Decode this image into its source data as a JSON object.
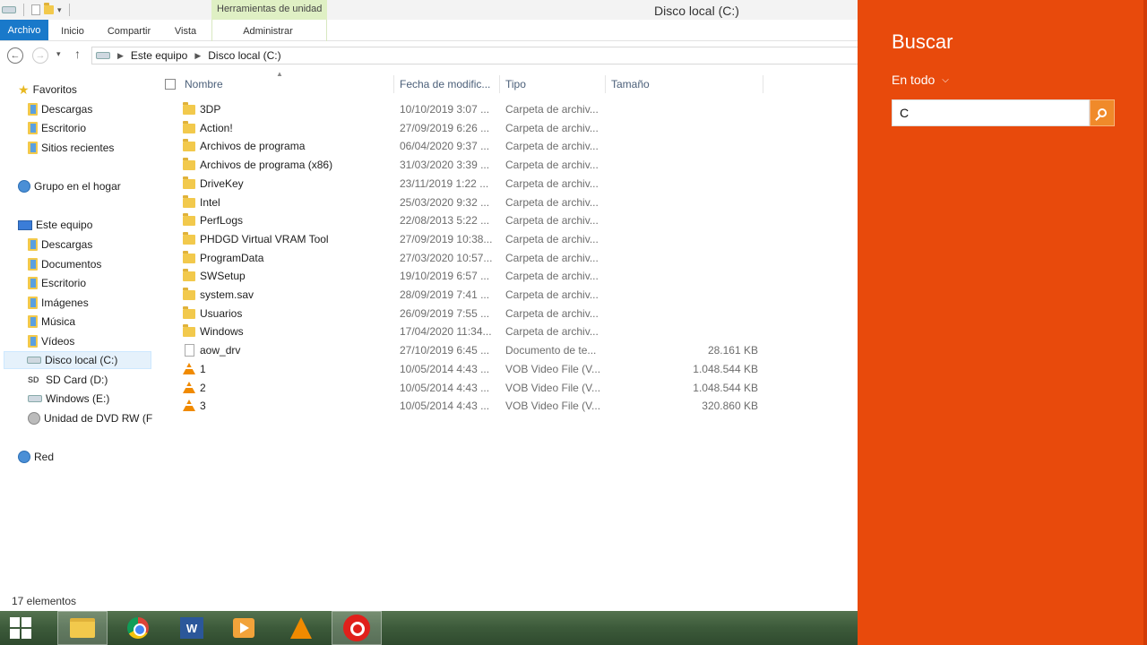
{
  "window": {
    "title": "Disco local (C:)",
    "tools_tab": "Herramientas de unidad"
  },
  "ribbon": {
    "tabs": [
      "Archivo",
      "Inicio",
      "Compartir",
      "Vista",
      "Administrar"
    ]
  },
  "address": {
    "crumbs": [
      "Este equipo",
      "Disco local (C:)"
    ]
  },
  "nav": {
    "favorites": "Favoritos",
    "fav_items": [
      "Descargas",
      "Escritorio",
      "Sitios recientes"
    ],
    "homegroup": "Grupo en el hogar",
    "this_pc": "Este equipo",
    "pc_items": [
      "Descargas",
      "Documentos",
      "Escritorio",
      "Imágenes",
      "Música",
      "Vídeos",
      "Disco local (C:)",
      "SD Card (D:)",
      "Windows (E:)",
      "Unidad de DVD RW (F"
    ],
    "network": "Red"
  },
  "columns": [
    "Nombre",
    "Fecha de modific...",
    "Tipo",
    "Tamaño"
  ],
  "files": [
    {
      "name": "3DP",
      "date": "10/10/2019 3:07 ...",
      "type": "Carpeta de archiv...",
      "size": "",
      "icon": "folder-icon"
    },
    {
      "name": "Action!",
      "date": "27/09/2019 6:26 ...",
      "type": "Carpeta de archiv...",
      "size": "",
      "icon": "folder-icon"
    },
    {
      "name": "Archivos de programa",
      "date": "06/04/2020 9:37 ...",
      "type": "Carpeta de archiv...",
      "size": "",
      "icon": "folder-icon"
    },
    {
      "name": "Archivos de programa (x86)",
      "date": "31/03/2020 3:39 ...",
      "type": "Carpeta de archiv...",
      "size": "",
      "icon": "folder-icon"
    },
    {
      "name": "DriveKey",
      "date": "23/11/2019 1:22 ...",
      "type": "Carpeta de archiv...",
      "size": "",
      "icon": "folder-icon"
    },
    {
      "name": "Intel",
      "date": "25/03/2020 9:32 ...",
      "type": "Carpeta de archiv...",
      "size": "",
      "icon": "folder-icon"
    },
    {
      "name": "PerfLogs",
      "date": "22/08/2013 5:22 ...",
      "type": "Carpeta de archiv...",
      "size": "",
      "icon": "folder-icon"
    },
    {
      "name": "PHDGD Virtual VRAM Tool",
      "date": "27/09/2019 10:38...",
      "type": "Carpeta de archiv...",
      "size": "",
      "icon": "folder-icon"
    },
    {
      "name": "ProgramData",
      "date": "27/03/2020 10:57...",
      "type": "Carpeta de archiv...",
      "size": "",
      "icon": "folder-icon"
    },
    {
      "name": "SWSetup",
      "date": "19/10/2019 6:57 ...",
      "type": "Carpeta de archiv...",
      "size": "",
      "icon": "folder-icon"
    },
    {
      "name": "system.sav",
      "date": "28/09/2019 7:41 ...",
      "type": "Carpeta de archiv...",
      "size": "",
      "icon": "folder-icon"
    },
    {
      "name": "Usuarios",
      "date": "26/09/2019 7:55 ...",
      "type": "Carpeta de archiv...",
      "size": "",
      "icon": "folder-icon"
    },
    {
      "name": "Windows",
      "date": "17/04/2020 11:34...",
      "type": "Carpeta de archiv...",
      "size": "",
      "icon": "folder-icon"
    },
    {
      "name": "aow_drv",
      "date": "27/10/2019 6:45 ...",
      "type": "Documento de te...",
      "size": "28.161 KB",
      "icon": "document-icon"
    },
    {
      "name": "1",
      "date": "10/05/2014 4:43 ...",
      "type": "VOB Video File (V...",
      "size": "1.048.544 KB",
      "icon": "vlc-icon"
    },
    {
      "name": "2",
      "date": "10/05/2014 4:43 ...",
      "type": "VOB Video File (V...",
      "size": "1.048.544 KB",
      "icon": "vlc-icon"
    },
    {
      "name": "3",
      "date": "10/05/2014 4:43 ...",
      "type": "VOB Video File (V...",
      "size": "320.860 KB",
      "icon": "vlc-icon"
    }
  ],
  "status": "17 elementos",
  "search": {
    "title": "Buscar",
    "scope": "En todo",
    "value": "C"
  },
  "taskbar": [
    "start-button",
    "file-explorer",
    "chrome",
    "word",
    "media-player",
    "vlc",
    "beats-audio"
  ],
  "colors": {
    "charm": "#e84a0c",
    "file_tab": "#1979ca",
    "tools_tab": "#dff0c4"
  }
}
